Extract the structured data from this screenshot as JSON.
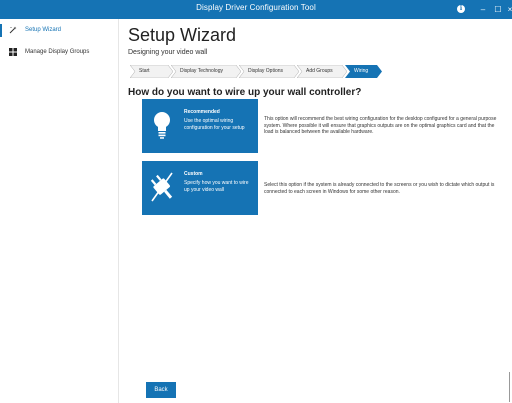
{
  "window": {
    "title": "Display Driver Configuration Tool",
    "controls": {
      "info": "i",
      "minimize": "–",
      "maximize": "☐",
      "close": "×"
    }
  },
  "sidebar": {
    "items": [
      {
        "label": "Setup Wizard",
        "icon": "wand-icon",
        "active": true
      },
      {
        "label": "Manage Display Groups",
        "icon": "grid-icon",
        "active": false
      }
    ]
  },
  "main": {
    "title": "Setup Wizard",
    "subtitle": "Designing your video wall",
    "steps": [
      {
        "label": "Start"
      },
      {
        "label": "Display Technology"
      },
      {
        "label": "Display Options"
      },
      {
        "label": "Add Groups"
      },
      {
        "label": "Wiring",
        "active": true
      }
    ],
    "question": "How do you want to wire up your wall controller?",
    "options": [
      {
        "title": "Recommended",
        "desc": "Use the optimal wiring configuration for your setup",
        "icon": "lightbulb-icon",
        "explanation": "This option will recommend the best wiring configuration for the desktop configured for a general purpose system. Where possible it will ensure that graphics outputs are on the optimal graphics card and that the load is balanced between the available hardware."
      },
      {
        "title": "Custom",
        "desc": "Specify how you want to wire up your video wall",
        "icon": "plug-icon",
        "explanation": "Select this option if the system is already connected to the screens or you wish to dictate which output is connected to each screen in Windows for some other reason."
      }
    ],
    "back_label": "Back"
  },
  "colors": {
    "accent": "#1573b4",
    "text": "#222222",
    "crumb_bg": "#f2f2f2"
  }
}
